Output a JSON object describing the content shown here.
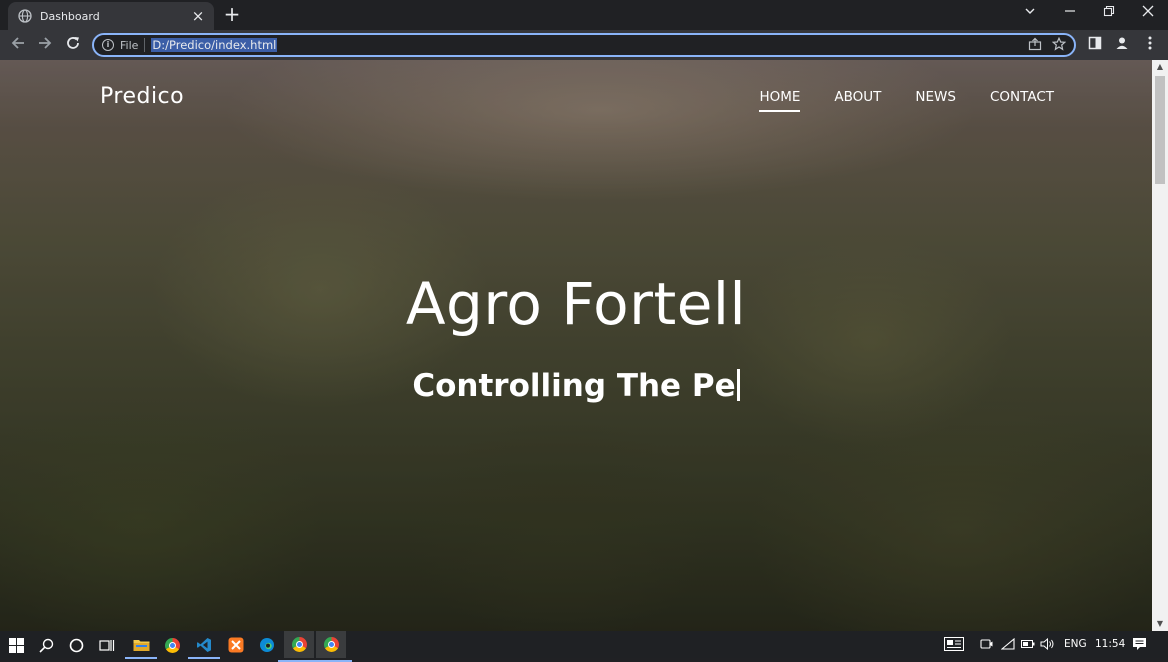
{
  "browser": {
    "tab_title": "Dashboard",
    "new_tab_symbol": "+",
    "address_scheme_label": "File",
    "url": "D:/Predico/index.html",
    "icons": [
      "globe-icon",
      "close-icon",
      "back-icon",
      "forward-icon",
      "reload-icon",
      "info-icon",
      "share-icon",
      "star-icon",
      "sidepanel-icon",
      "profile-icon",
      "menu-icon",
      "tab-search-icon",
      "minimize-icon",
      "restore-icon",
      "window-close-icon"
    ]
  },
  "page": {
    "brand": "Predico",
    "nav": [
      {
        "label": "HOME",
        "active": true
      },
      {
        "label": "ABOUT",
        "active": false
      },
      {
        "label": "NEWS",
        "active": false
      },
      {
        "label": "CONTACT",
        "active": false
      }
    ],
    "hero_title": "Agro Fortell",
    "hero_subtitle": "Controlling The Pe"
  },
  "taskbar": {
    "language": "ENG",
    "time": "11:54",
    "accent_color": "#8ab4f8"
  }
}
